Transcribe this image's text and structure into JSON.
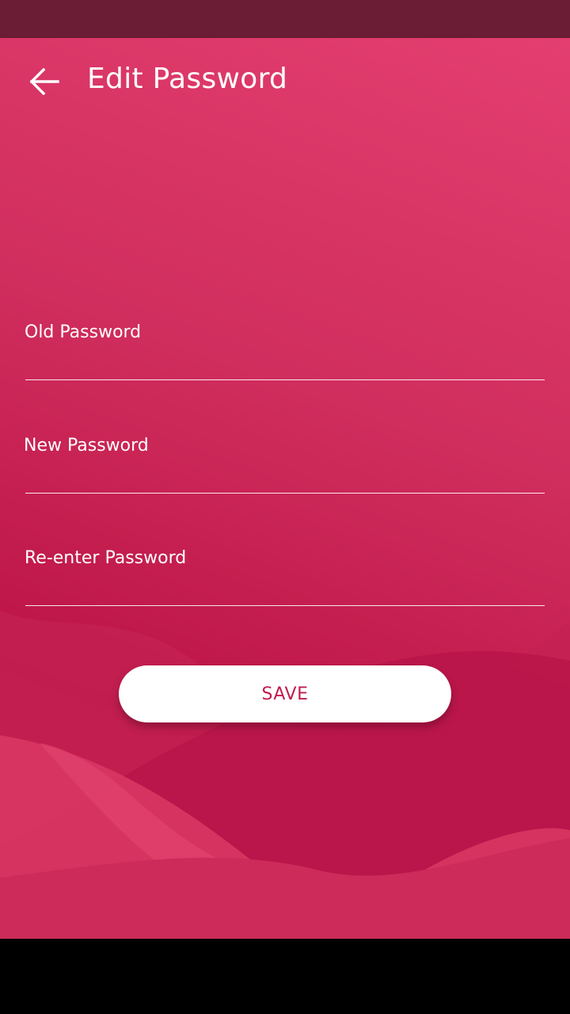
{
  "colors": {
    "status_bar": "#6a1d35",
    "background_top": "#e33e6f",
    "background_bottom": "#bc1346",
    "accent_text": "#c41a4c",
    "button_background": "#ffffff",
    "text": "#ffffff"
  },
  "header": {
    "back_icon": "arrow-left-icon",
    "title": "Edit Password"
  },
  "form": {
    "fields": [
      {
        "label": "Old Password",
        "value": ""
      },
      {
        "label": "New Password",
        "value": ""
      },
      {
        "label": "Re-enter Password",
        "value": ""
      }
    ],
    "save_label": "SAVE"
  }
}
